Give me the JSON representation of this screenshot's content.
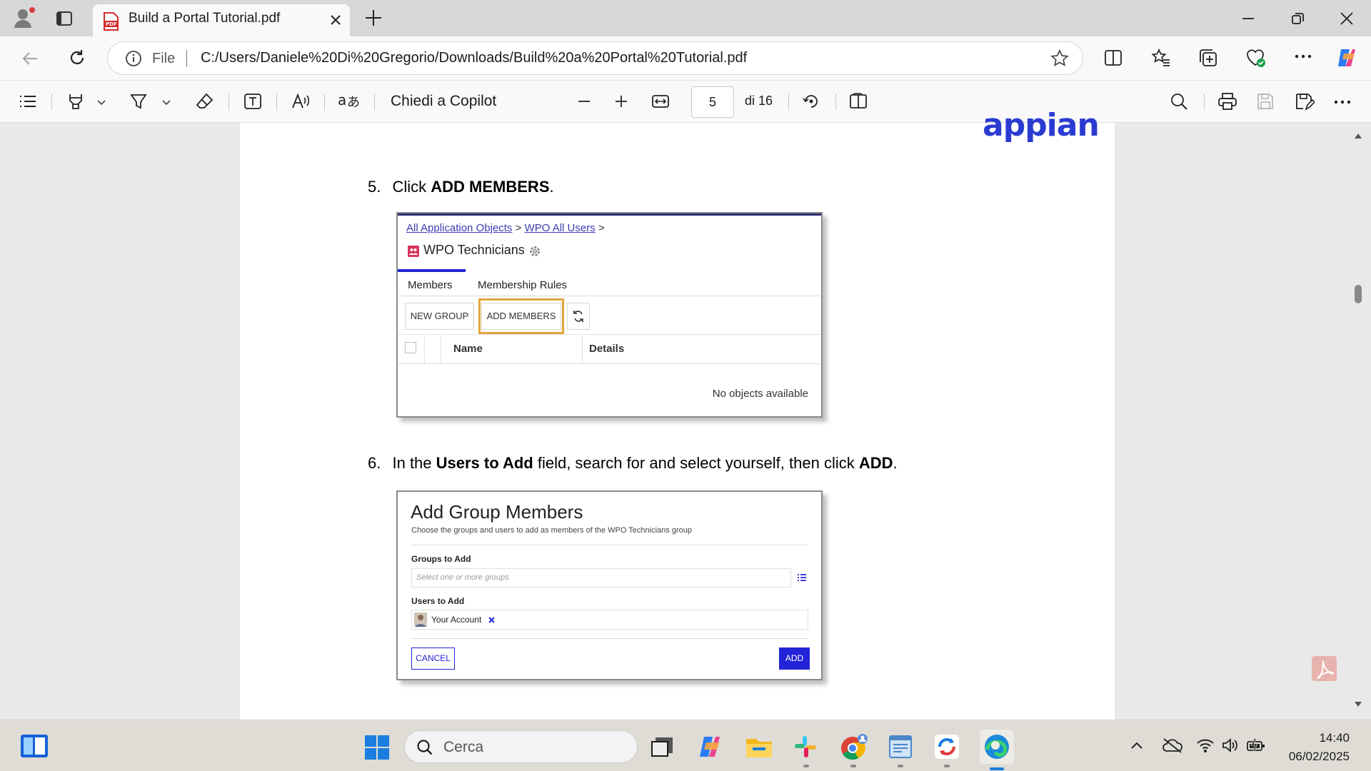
{
  "browser": {
    "tab_title": "Build a Portal Tutorial.pdf",
    "new_tab_symbol": "+",
    "address": {
      "scheme_label": "File",
      "url": "C:/Users/Daniele%20Di%20Gregorio/Downloads/Build%20a%20Portal%20Tutorial.pdf"
    }
  },
  "pdf_toolbar": {
    "copilot_label": "Chiedi a Copilot",
    "page_current": "5",
    "page_total": "di 16"
  },
  "document": {
    "logo_text": "appian",
    "step5": {
      "number": "5.",
      "pre": "Click ",
      "bold": "ADD MEMBERS",
      "post": "."
    },
    "shot1": {
      "breadcrumb_1": "All Application Objects",
      "breadcrumb_sep1": " > ",
      "breadcrumb_2": "WPO All Users",
      "breadcrumb_sep2": " >",
      "group_title": "WPO Technicians",
      "tab_members": "Members",
      "tab_rules": "Membership Rules",
      "btn_new_group": "NEW GROUP",
      "btn_add_members": "ADD MEMBERS",
      "col_name": "Name",
      "col_details": "Details",
      "empty_text": "No objects available"
    },
    "step6": {
      "number": "6.",
      "t1": "In the ",
      "b1": "Users to Add",
      "t2": " field, search for and select yourself, then click ",
      "b2": "ADD",
      "t3": "."
    },
    "shot2": {
      "title": "Add Group Members",
      "subtitle": "Choose the groups and users to add as members of the WPO Technicians group",
      "groups_label": "Groups to Add",
      "groups_placeholder": "Select one or more groups",
      "users_label": "Users to Add",
      "user_chip": "Your Account",
      "cancel": "CANCEL",
      "add": "ADD"
    }
  },
  "taskbar": {
    "search_placeholder": "Cerca",
    "time": "14:40",
    "date": "06/02/2025"
  },
  "colors": {
    "accent_blue": "#2323d8",
    "pdf_red": "#d62b2b",
    "appian_blue": "#2a3bd1",
    "highlight_orange": "#e3a63a"
  }
}
